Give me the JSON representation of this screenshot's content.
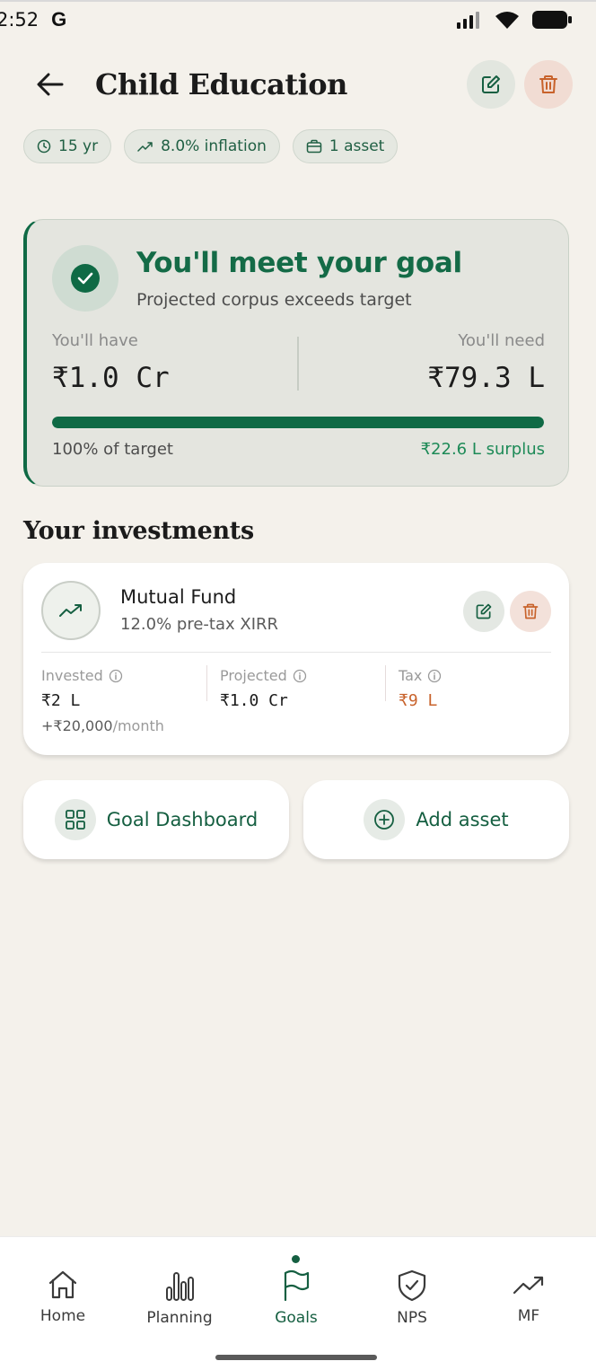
{
  "status_bar": {
    "time": "2:52",
    "g_logo": "G"
  },
  "header": {
    "title": "Child Education"
  },
  "chips": [
    {
      "icon": "clock-icon",
      "label": "15 yr"
    },
    {
      "icon": "trend-up-icon",
      "label": "8.0% inflation"
    },
    {
      "icon": "briefcase-icon",
      "label": "1 asset"
    }
  ],
  "goal_status": {
    "headline": "You'll meet your goal",
    "subtitle": "Projected corpus exceeds target",
    "have_label": "You'll have",
    "have_value": "₹1.0 Cr",
    "need_label": "You'll need",
    "need_value": "₹79.3 L",
    "progress_fraction": 1.0,
    "percent_label": "100% of target",
    "surplus_label": "₹22.6 L surplus"
  },
  "investments": {
    "title": "Your investments",
    "items": [
      {
        "name": "Mutual Fund",
        "xirr": "12.0% pre-tax XIRR",
        "invested_label": "Invested",
        "invested_value": "₹2 L",
        "projected_label": "Projected",
        "projected_value": "₹1.0 Cr",
        "tax_label": "Tax",
        "tax_value": "₹9 L",
        "monthly_amount": "+₹20,000",
        "monthly_suffix": "/month"
      }
    ]
  },
  "actions": {
    "dashboard_label": "Goal Dashboard",
    "add_asset_label": "Add asset"
  },
  "bottom_nav": [
    {
      "label": "Home",
      "icon": "home-icon"
    },
    {
      "label": "Planning",
      "icon": "bar-chart-icon"
    },
    {
      "label": "Goals",
      "icon": "flag-icon",
      "active": true
    },
    {
      "label": "NPS",
      "icon": "shield-check-icon"
    },
    {
      "label": "MF",
      "icon": "trend-up-icon"
    }
  ],
  "colors": {
    "brand_green": "#0f6a45",
    "danger": "#c8622b",
    "background": "#f4f1eb"
  }
}
